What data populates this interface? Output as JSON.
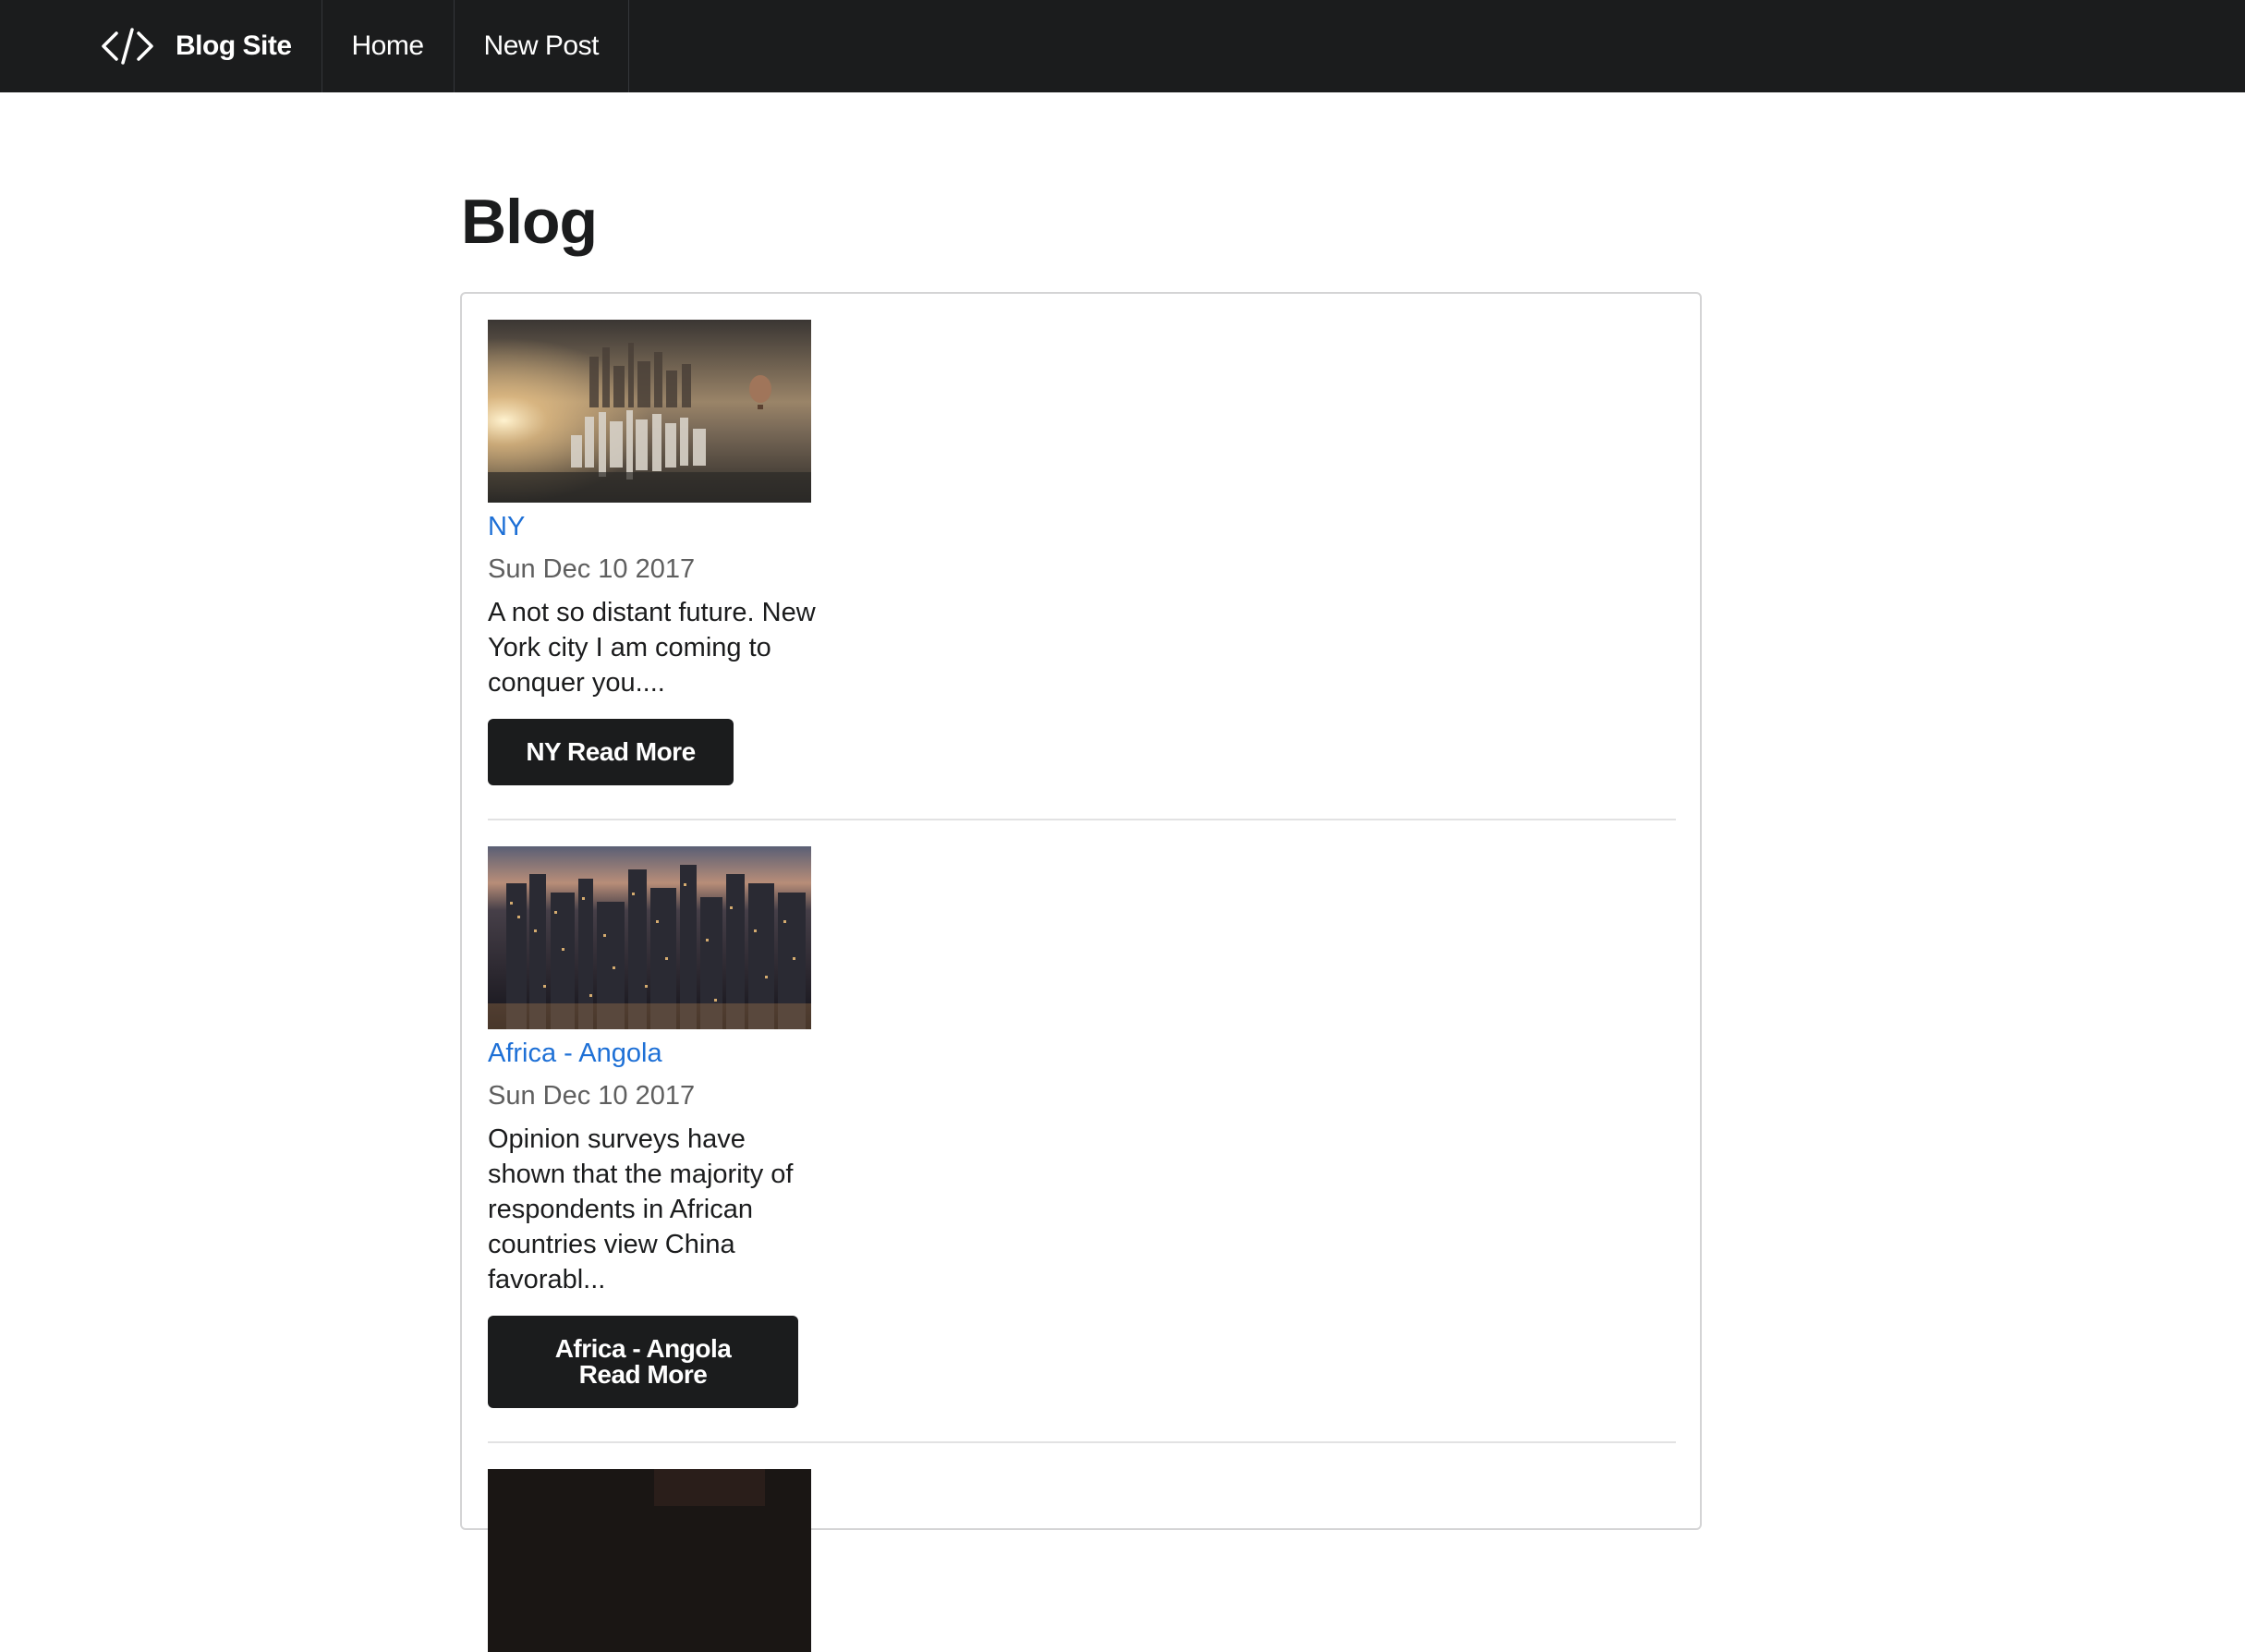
{
  "navbar": {
    "brand": {
      "icon": "code-brackets-icon",
      "label": "Blog Site"
    },
    "items": [
      {
        "label": "Home"
      },
      {
        "label": "New Post"
      }
    ]
  },
  "page": {
    "title": "Blog"
  },
  "posts": [
    {
      "title": "NY",
      "date": "Sun Dec 10 2017",
      "excerpt": "A not so distant future. New York city I am coming to conquer you....",
      "button": "NY Read More",
      "image": "city-skyline-sunset-image"
    },
    {
      "title": "Africa - Angola",
      "date": "Sun Dec 10 2017",
      "excerpt": "Opinion surveys have shown that the majority of respondents in African countries view China favorabl...",
      "button_line1": "Africa - Angola",
      "button_line2": "Read More",
      "image": "city-skyline-night-image"
    },
    {
      "image": "dark-thumbnail-image"
    }
  ],
  "colors": {
    "navbar_bg": "#1b1c1d",
    "link": "#1e70d6",
    "button_bg": "#1b1c1d",
    "text": "#1b1c1d",
    "meta": "#5f5f5f"
  }
}
